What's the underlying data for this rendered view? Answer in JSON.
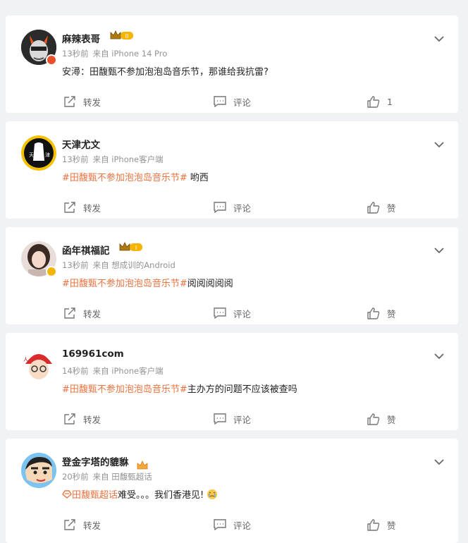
{
  "comments": [
    {
      "name": "麻辣表哥",
      "time": "13秒前",
      "source": "来自 iPhone 14 Pro",
      "topic": "",
      "text": "安潯：田馥甄不参加泡泡岛音乐节，那谁给我抗雷?",
      "repost_label": "转发",
      "comment_label": "评论",
      "like_label": "1",
      "has_crown": true,
      "crown_level": "II",
      "verified": "red",
      "avatar_icon": "masked-face-avatar"
    },
    {
      "name": "天津尤文",
      "time": "13秒前",
      "source": "来自 iPhone客户端",
      "topic": "#田馥甄不参加泡泡岛音乐节#",
      "text": " 哟西",
      "repost_label": "转发",
      "comment_label": "评论",
      "like_label": "赞",
      "has_crown": false,
      "verified": "",
      "avatar_icon": "tianjin-logo-avatar"
    },
    {
      "name": "函年祺福記",
      "time": "13秒前",
      "source": "来自 想成训的Android",
      "topic": "#田馥甄不参加泡泡岛音乐节#",
      "text": "阅阅阅阅阅",
      "repost_label": "转发",
      "comment_label": "评论",
      "like_label": "赞",
      "has_crown": true,
      "crown_level": "I",
      "verified": "gold",
      "avatar_icon": "girl-photo-avatar"
    },
    {
      "name": "169961com",
      "time": "14秒前",
      "source": "来自 iPhone客户端",
      "topic": "#田馥甄不参加泡泡岛音乐节#",
      "text": "主办方的问题不应该被查吗",
      "repost_label": "转发",
      "comment_label": "评论",
      "like_label": "赞",
      "has_crown": false,
      "verified": "",
      "avatar_icon": "cartoon-boy-avatar"
    },
    {
      "name": "登金字塔的貔貅",
      "time": "20秒前",
      "source": "来自 田馥甄超话",
      "topic": "田馥甄超话",
      "text": "难受。。。我们香港见!",
      "repost_label": "转发",
      "comment_label": "评论",
      "like_label": "赞",
      "has_crown": true,
      "crown_level": "",
      "verified": "",
      "avatar_icon": "crayon-shinchan-avatar"
    }
  ],
  "colors": {
    "topic": "#eb7340",
    "meta": "#939393",
    "background": "#f1f2f5"
  }
}
